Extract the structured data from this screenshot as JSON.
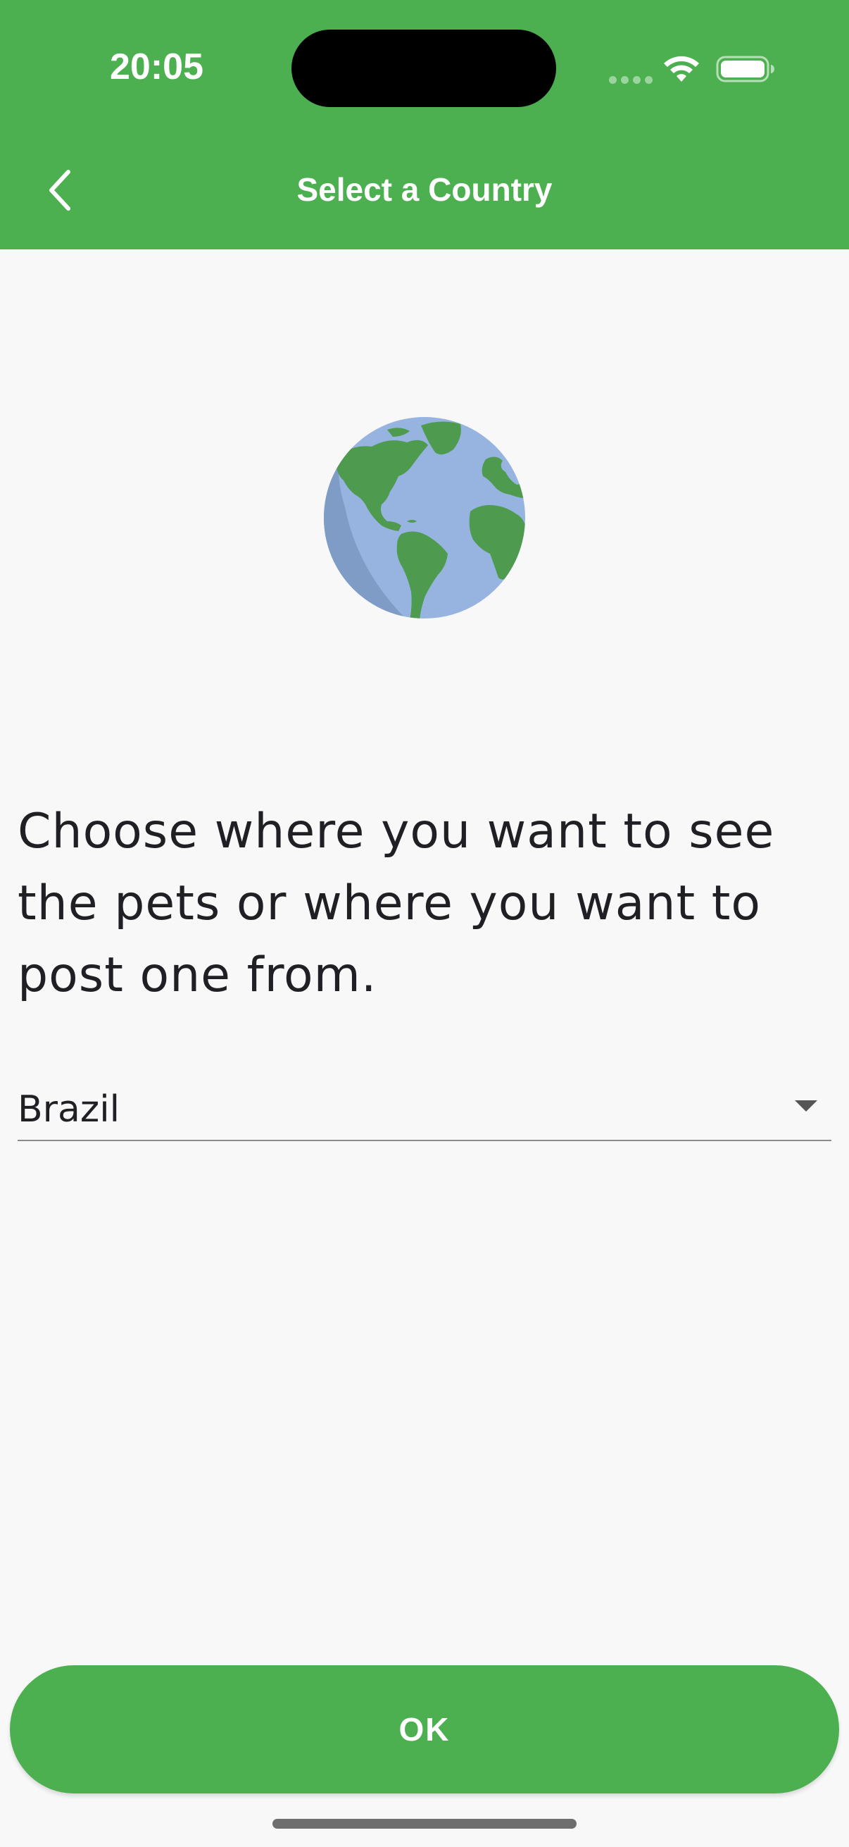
{
  "status_bar": {
    "time": "20:05"
  },
  "app_bar": {
    "title": "Select a Country",
    "back_icon": "chevron-left-icon",
    "background": "#4caf50"
  },
  "illustration": {
    "icon": "globe-icon"
  },
  "main": {
    "headline": "Choose where you want to see the pets or where you want to post one from."
  },
  "country_dropdown": {
    "selected": "Brazil",
    "icon": "dropdown-arrow-icon"
  },
  "actions": {
    "ok_label": "OK"
  },
  "colors": {
    "accent": "#4caf50",
    "ocean": "#97b4e0",
    "land": "#4e9a4e"
  }
}
